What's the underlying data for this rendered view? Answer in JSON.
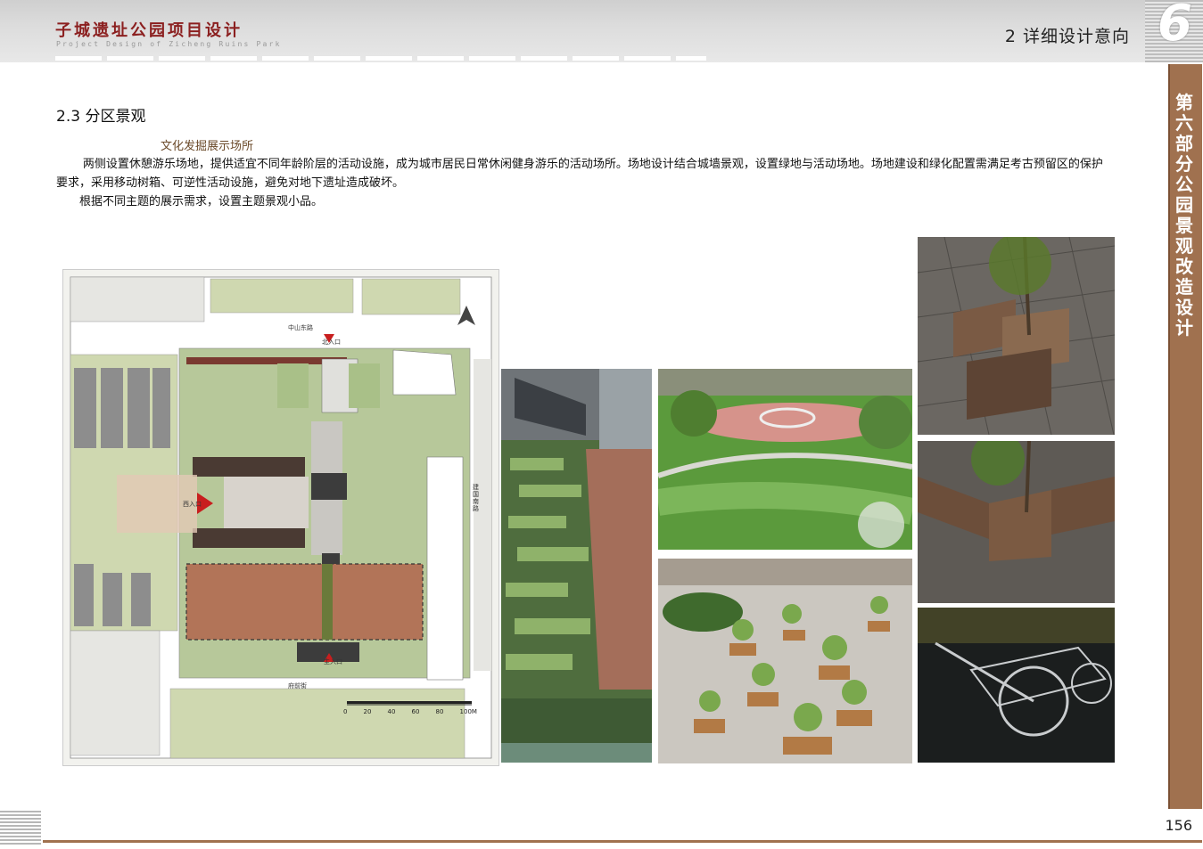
{
  "header": {
    "doc_title": "子城遗址公园项目设计",
    "doc_subtitle": "Project Design of Zicheng Ruins Park",
    "section_title": "2 详细设计意向",
    "chapter_number": "6"
  },
  "side_tab": {
    "text": "第六部分 公园景观改造设计"
  },
  "content": {
    "sub_heading": "2.3 分区景观",
    "topic": "文化发掘展示场所",
    "paragraph1": "两侧设置休憩游乐场地，提供适宜不同年龄阶层的活动设施，成为城市居民日常休闲健身游乐的活动场所。场地设计结合城墙景观，设置绿地与活动场地。场地建设和绿化配置需满足考古预留区的保护要求，采用移动树箱、可逆性活动设施，避免对地下遗址造成破坏。",
    "paragraph2": "根据不同主题的展示需求，设置主题景观小品。"
  },
  "plan_labels": {
    "north_road": "中山东路",
    "north_entrance": "北入口",
    "west_entrance": "西入口",
    "main_entrance": "主入口",
    "east_road": "建国南路",
    "south_road": "府前街",
    "scale": [
      "0",
      "20",
      "40",
      "60",
      "80",
      "100M"
    ]
  },
  "footer": {
    "page_number": "156"
  },
  "colors": {
    "title_red": "#8b1f1f",
    "brown_accent": "#a0714f"
  }
}
